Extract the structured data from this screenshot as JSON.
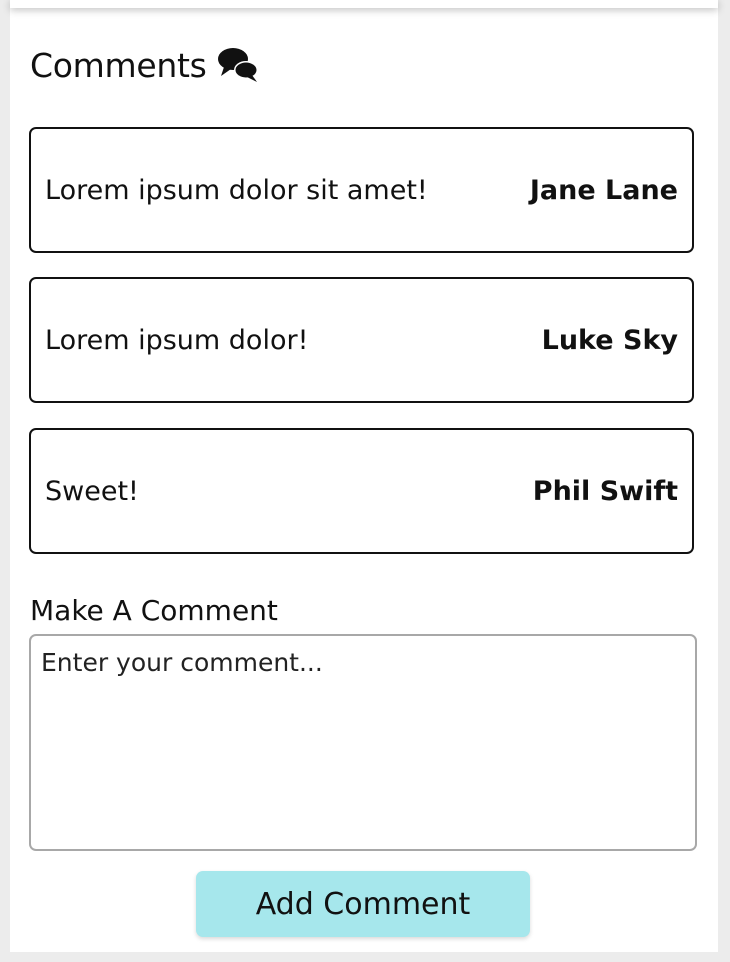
{
  "comments_section": {
    "title": "Comments",
    "title_icon": "comments-icon",
    "items": [
      {
        "text": "Lorem ipsum dolor sit amet!",
        "author": "Jane Lane"
      },
      {
        "text": "Lorem ipsum dolor!",
        "author": "Luke Sky"
      },
      {
        "text": "Sweet!",
        "author": "Phil Swift"
      }
    ]
  },
  "new_comment": {
    "label": "Make A Comment",
    "placeholder": "Enter your comment...",
    "value": "",
    "submit_label": "Add Comment"
  },
  "colors": {
    "button_background": "#a6e7ec",
    "page_background": "#ffffff",
    "outer_background": "#ececec"
  }
}
